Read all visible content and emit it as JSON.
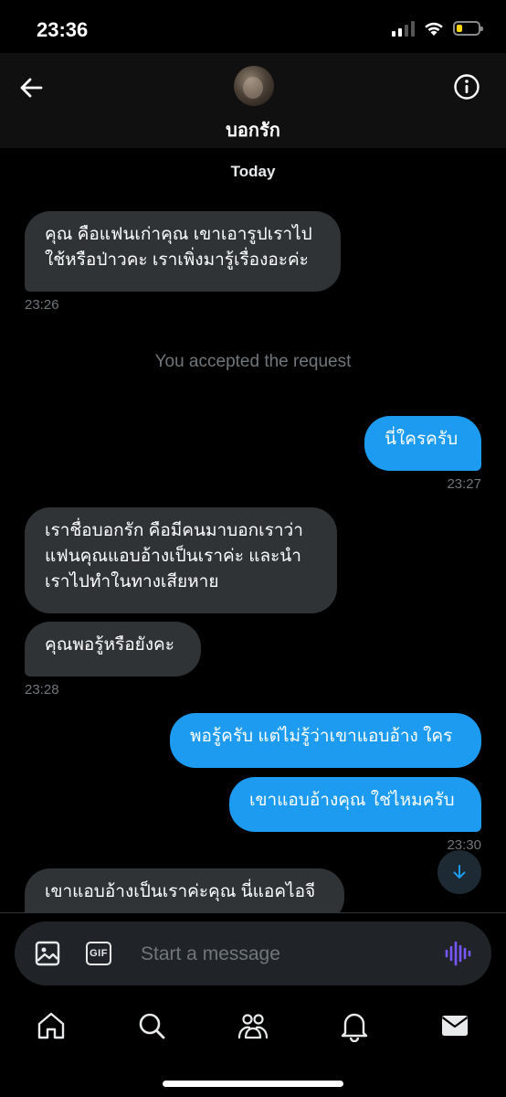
{
  "status_bar": {
    "time": "23:36",
    "battery_level": 0.25,
    "battery_color": "#ffd60a"
  },
  "header": {
    "contact_name": "บอกรัก",
    "back_icon": "arrow-left-icon",
    "info_icon": "info-circle-icon"
  },
  "chat": {
    "day_label": "Today",
    "messages": [
      {
        "direction": "in",
        "text_lines": [
          "คุณ คือแฟนเก่าคุณ เขาเอารูปเราไป",
          "ใช้หรือป่าวคะ เราเพิ่งมารู้เรื่องอะค่ะ"
        ],
        "time": "23:26"
      },
      {
        "system": "You accepted the request"
      },
      {
        "direction": "out",
        "text_lines": [
          "นี่ใครครับ"
        ],
        "time": "23:27"
      },
      {
        "direction": "in",
        "text_lines": [
          "เราชื่อบอกรัก คือมีคนมาบอกเราว่า",
          "แฟนคุณแอบอ้างเป็นเราค่ะ และนำ",
          "เราไปทำในทางเสียหาย"
        ]
      },
      {
        "direction": "in",
        "text_lines": [
          "คุณพอรู้หรือยังคะ"
        ],
        "time": "23:28"
      },
      {
        "direction": "out",
        "text_lines": [
          "พอรู้ครับ แต่ไม่รู้ว่าเขาแอบอ้าง ใคร"
        ]
      },
      {
        "direction": "out",
        "text_lines": [
          "เขาแอบอ้างคุณ ใช่ไหมครับ"
        ],
        "time": "23:30"
      },
      {
        "direction": "in",
        "text_lines": [
          "เขาแอบอ้างเป็นเราค่ะคุณ นี่แอคไอจี"
        ]
      }
    ]
  },
  "composer": {
    "placeholder": "Start a message",
    "gif_label": "GIF",
    "voice_color": "#7856ff"
  },
  "nav": {
    "items": [
      "home-icon",
      "search-icon",
      "communities-icon",
      "notifications-icon",
      "messages-icon"
    ]
  },
  "colors": {
    "outgoing_bubble": "#1d9bf0",
    "incoming_bubble": "#2f3336",
    "background": "#000000"
  }
}
